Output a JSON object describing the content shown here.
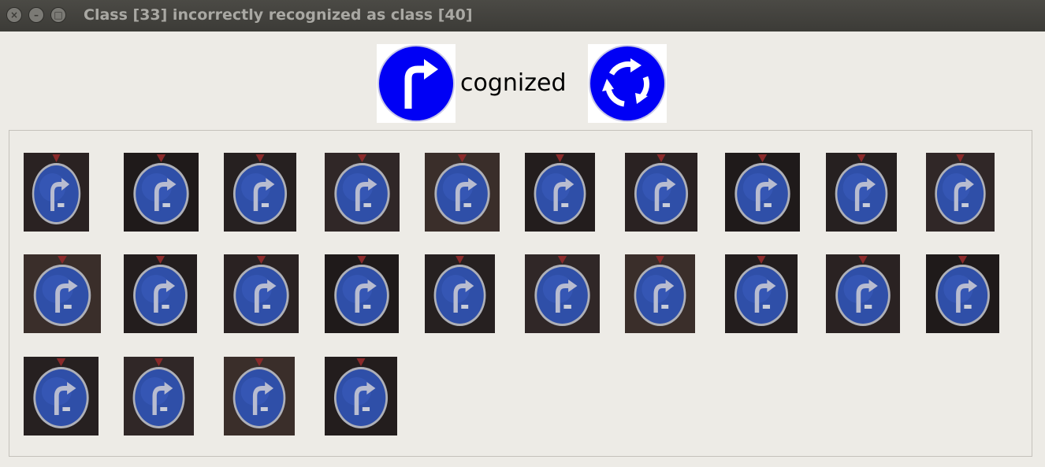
{
  "window": {
    "title": "Class [33] incorrectly recognized as class [40]",
    "close_icon": "close-icon",
    "minimize_icon": "minimize-icon",
    "maximize_icon": "maximize-icon"
  },
  "header": {
    "true_class_icon": "turn-right-ahead-sign-icon",
    "label": "cognized",
    "predicted_class_icon": "roundabout-sign-icon"
  },
  "samples": {
    "count": 24,
    "icon": "turn-right-ahead-sign-icon"
  }
}
